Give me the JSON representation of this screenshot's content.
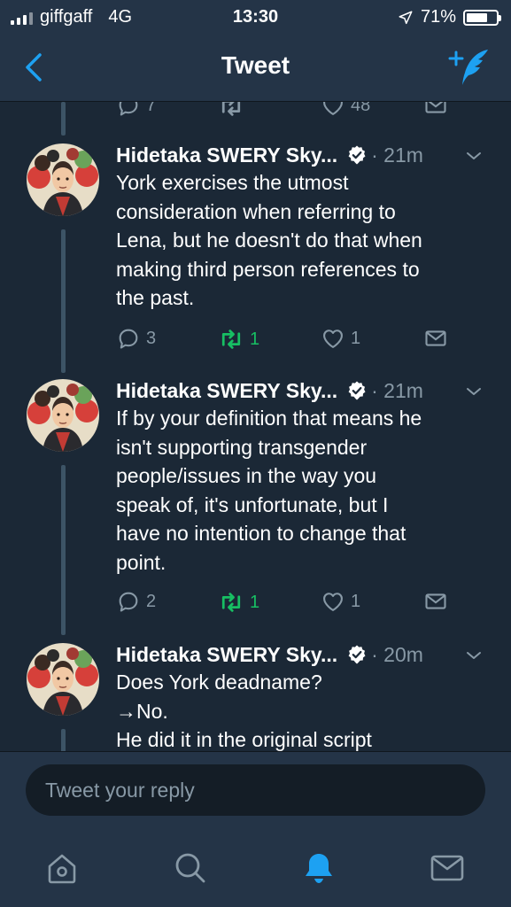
{
  "status_bar": {
    "carrier": "giffgaff",
    "network": "4G",
    "time": "13:30",
    "battery": "71%",
    "battery_level": 0.71
  },
  "nav": {
    "title": "Tweet"
  },
  "top_actions": {
    "reply_count": "7",
    "retweet_count": "",
    "like_count": "48"
  },
  "tweets": [
    {
      "name": "Hidetaka SWERY Sky...",
      "time": "· 21m",
      "text": "York exercises the utmost\nconsideration when referring to\nLena, but he doesn't do that when\nmaking third person references to\nthe past.",
      "replies": "3",
      "retweets": "1",
      "likes": "1"
    },
    {
      "name": "Hidetaka SWERY Sky...",
      "time": "· 21m",
      "text": "If by your definition that means he\nisn't supporting transgender\npeople/issues in the way you\nspeak of, it's unfortunate, but I\nhave no intention to change that\npoint.",
      "replies": "2",
      "retweets": "1",
      "likes": "1"
    },
    {
      "name": "Hidetaka SWERY Sky...",
      "time": "· 20m",
      "text": "Does York deadname?\n→No.\nHe did it in the original script"
    }
  ],
  "reply": {
    "placeholder": "Tweet your reply"
  },
  "tab_bar": {
    "items": [
      "home-icon",
      "search-icon",
      "notifications-icon",
      "messages-icon"
    ],
    "active": "notifications-icon"
  },
  "colors": {
    "background": "#1b2836",
    "bar": "#243447",
    "accent": "#1da1f2",
    "retweet": "#17bf63",
    "muted": "#8899a6"
  }
}
